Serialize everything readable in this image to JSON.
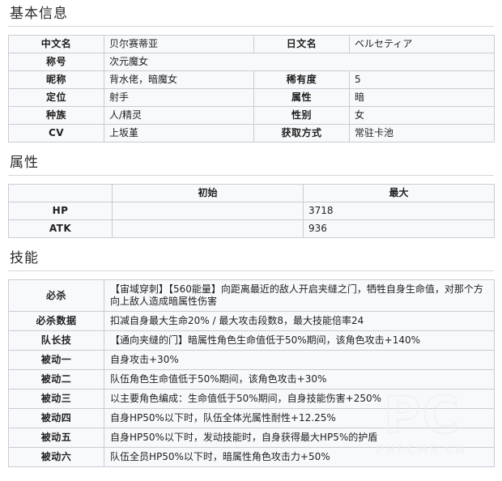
{
  "sections": {
    "basic": {
      "heading": "基本信息",
      "rows": [
        {
          "label1": "中文名",
          "value1": "贝尔赛蒂亚",
          "label2": "日文名",
          "value2": "ベルセティア"
        },
        {
          "label1": "称号",
          "value1": "次元魔女",
          "span": true
        },
        {
          "label1": "昵称",
          "value1": "背水佬，暗魔女",
          "label2": "稀有度",
          "value2": "5"
        },
        {
          "label1": "定位",
          "value1": "射手",
          "label2": "属性",
          "value2": "暗"
        },
        {
          "label1": "种族",
          "value1": "人/精灵",
          "label2": "性别",
          "value2": "女"
        },
        {
          "label1": "CV",
          "value1": "上坂堇",
          "label2": "获取方式",
          "value2": "常驻卡池"
        }
      ]
    },
    "attributes": {
      "heading": "属性",
      "columns": [
        "",
        "初始",
        "最大"
      ],
      "rows": [
        {
          "name": "HP",
          "initial": "",
          "max": "3718"
        },
        {
          "name": "ATK",
          "initial": "",
          "max": "936"
        }
      ]
    },
    "skills": {
      "heading": "技能",
      "rows": [
        {
          "label": "必杀",
          "text": "【宙域穿刺】【560能量】向距离最近的敌人开启夹缝之门，牺牲自身生命值，对那个方向上敌人造成暗属性伤害"
        },
        {
          "label": "必杀数据",
          "text": "扣减自身最大生命20% / 最大攻击段数8，最大技能倍率24"
        },
        {
          "label": "队长技",
          "text": "【通向夹缝的门】暗属性角色生命值低于50%期间，该角色攻击+140%"
        },
        {
          "label": "被动一",
          "text": "自身攻击+30%"
        },
        {
          "label": "被动二",
          "text": "队伍角色生命值低于50%期间，该角色攻击+30%"
        },
        {
          "label": "被动三",
          "text": "以主要角色编成：生命值低于50%期间，自身技能伤害+250%"
        },
        {
          "label": "被动四",
          "text": "自身HP50%以下时，队伍全体光属性耐性+12.25%"
        },
        {
          "label": "被动五",
          "text": "自身HP50%以下时，发动技能时，自身获得最大HP5%的护盾"
        },
        {
          "label": "被动六",
          "text": "队伍全员HP50%以下时，暗属性角色攻击力+50%"
        }
      ]
    }
  },
  "watermark": {
    "logo": "PC",
    "text": "PHPCMS.CN"
  },
  "colors": {
    "label_bg": "#e9ebf0",
    "value_bg": "#f8f9fb",
    "border": "#c9ccd3",
    "heading_rule": "#d4d7dc",
    "text": "#1f1f1f"
  }
}
